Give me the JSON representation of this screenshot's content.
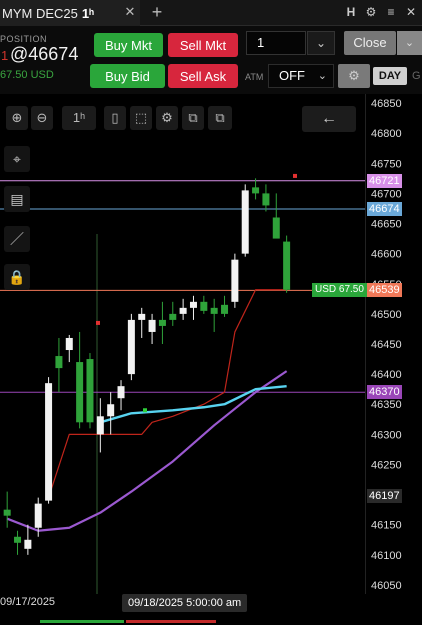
{
  "tab": {
    "title": "MYM DEC25",
    "timeframe": "1ʰ",
    "close_glyph": "✕",
    "add_glyph": "+"
  },
  "window_icons": [
    "H",
    "⚙",
    "≡",
    "✕"
  ],
  "position": {
    "label": "POSITION",
    "qty": "1",
    "price": "@46674",
    "pnl": "67.50 USD"
  },
  "orders": {
    "buy_mkt": "Buy Mkt",
    "sell_mkt": "Sell Mkt",
    "buy_bid": "Buy Bid",
    "sell_ask": "Sell Ask",
    "quantity": "1",
    "quantity_chevron": "⌄",
    "close": "Close",
    "close_chevron": "⌄",
    "atm_label": "ATM",
    "atm_value": "OFF",
    "atm_chevron": "⌄",
    "gear_glyph": "⚙",
    "tif": "DAY",
    "tif_cut": "G"
  },
  "toolbar": {
    "zoom_in": "⊕",
    "zoom_out": "⊖",
    "timeframe": "1ʰ",
    "bar_style": "▯",
    "select": "⬚",
    "settings": "⚙",
    "copy": "⧉",
    "back": "←"
  },
  "side_tools": {
    "crosshair": "⌖",
    "list": "▤",
    "draw": "／",
    "lock": "🔒"
  },
  "colors": {
    "up_candle": "#f2f2f2",
    "down_candle": "#2fa33a",
    "sma_cyan": "#58d3f0",
    "trend_purple": "#9b59d0",
    "trail_red": "#c0251b",
    "last_price": "#f07858",
    "entry_price": "#6aa8d8",
    "high_line": "#d890e8",
    "low_line": "#9a46b8"
  },
  "price_tags": [
    {
      "text": "46721",
      "bg": "#d890e8"
    },
    {
      "text": "46674",
      "bg": "#6aa8d8"
    },
    {
      "text": "46539",
      "bg": "#f07858"
    },
    {
      "text": "46370",
      "bg": "#9a46b8"
    },
    {
      "text": "46197",
      "bg": "#2a2a2a"
    }
  ],
  "usd_tag": "USD 67.50",
  "time_axis": {
    "left": "09/17/2025",
    "highlight": "09/18/2025 5:00:00 am"
  },
  "chart_data": {
    "type": "candlestick",
    "instrument": "MYM DEC25",
    "timeframe": "1h",
    "y_ticks": [
      46850,
      46800,
      46750,
      46700,
      46650,
      46600,
      46550,
      46500,
      46450,
      46400,
      46350,
      46300,
      46250,
      46200,
      46150,
      46100,
      46050
    ],
    "ylim": [
      46035,
      46865
    ],
    "candles": [
      {
        "o": 46175,
        "h": 46205,
        "l": 46145,
        "c": 46165
      },
      {
        "o": 46130,
        "h": 46140,
        "l": 46100,
        "c": 46120
      },
      {
        "o": 46110,
        "h": 46150,
        "l": 46100,
        "c": 46125
      },
      {
        "o": 46145,
        "h": 46195,
        "l": 46130,
        "c": 46185
      },
      {
        "o": 46190,
        "h": 46395,
        "l": 46185,
        "c": 46385
      },
      {
        "o": 46430,
        "h": 46460,
        "l": 46370,
        "c": 46410
      },
      {
        "o": 46440,
        "h": 46465,
        "l": 46420,
        "c": 46460
      },
      {
        "o": 46420,
        "h": 46470,
        "l": 46310,
        "c": 46320
      },
      {
        "o": 46425,
        "h": 46435,
        "l": 46310,
        "c": 46320
      },
      {
        "o": 46300,
        "h": 46360,
        "l": 46270,
        "c": 46330
      },
      {
        "o": 46330,
        "h": 46370,
        "l": 46300,
        "c": 46350
      },
      {
        "o": 46360,
        "h": 46390,
        "l": 46340,
        "c": 46380
      },
      {
        "o": 46400,
        "h": 46500,
        "l": 46390,
        "c": 46490
      },
      {
        "o": 46490,
        "h": 46510,
        "l": 46460,
        "c": 46500
      },
      {
        "o": 46470,
        "h": 46500,
        "l": 46450,
        "c": 46490
      },
      {
        "o": 46490,
        "h": 46520,
        "l": 46450,
        "c": 46480
      },
      {
        "o": 46500,
        "h": 46520,
        "l": 46480,
        "c": 46490
      },
      {
        "o": 46500,
        "h": 46525,
        "l": 46490,
        "c": 46510
      },
      {
        "o": 46510,
        "h": 46530,
        "l": 46490,
        "c": 46520
      },
      {
        "o": 46520,
        "h": 46530,
        "l": 46500,
        "c": 46505
      },
      {
        "o": 46510,
        "h": 46525,
        "l": 46470,
        "c": 46500
      },
      {
        "o": 46515,
        "h": 46530,
        "l": 46495,
        "c": 46500
      },
      {
        "o": 46520,
        "h": 46600,
        "l": 46510,
        "c": 46590
      },
      {
        "o": 46600,
        "h": 46715,
        "l": 46595,
        "c": 46705
      },
      {
        "o": 46710,
        "h": 46725,
        "l": 46690,
        "c": 46700
      },
      {
        "o": 46700,
        "h": 46715,
        "l": 46670,
        "c": 46680
      },
      {
        "o": 46660,
        "h": 46700,
        "l": 46640,
        "c": 46625
      },
      {
        "o": 46620,
        "h": 46630,
        "l": 46535,
        "c": 46540
      }
    ],
    "lines": {
      "last_price": 46539,
      "entry_price": 46674,
      "high": 46721,
      "low": 46370,
      "prior": 46197
    },
    "sma_cyan": [
      [
        9,
        46320
      ],
      [
        12,
        46335
      ],
      [
        16,
        46340
      ],
      [
        19,
        46345
      ],
      [
        21,
        46350
      ],
      [
        24,
        46375
      ],
      [
        27,
        46380
      ]
    ],
    "trend_purple": [
      [
        0,
        46160
      ],
      [
        3,
        46140
      ],
      [
        6,
        46145
      ],
      [
        9,
        46170
      ],
      [
        12,
        46205
      ],
      [
        16,
        46255
      ],
      [
        20,
        46315
      ],
      [
        24,
        46370
      ],
      [
        27,
        46405
      ]
    ],
    "trail_red": [
      [
        4,
        46195
      ],
      [
        6,
        46300
      ],
      [
        13,
        46300
      ],
      [
        14,
        46320
      ],
      [
        16,
        46330
      ],
      [
        19,
        46350
      ],
      [
        21,
        46370
      ],
      [
        22,
        46470
      ],
      [
        24,
        46540
      ],
      [
        27,
        46540
      ]
    ]
  }
}
